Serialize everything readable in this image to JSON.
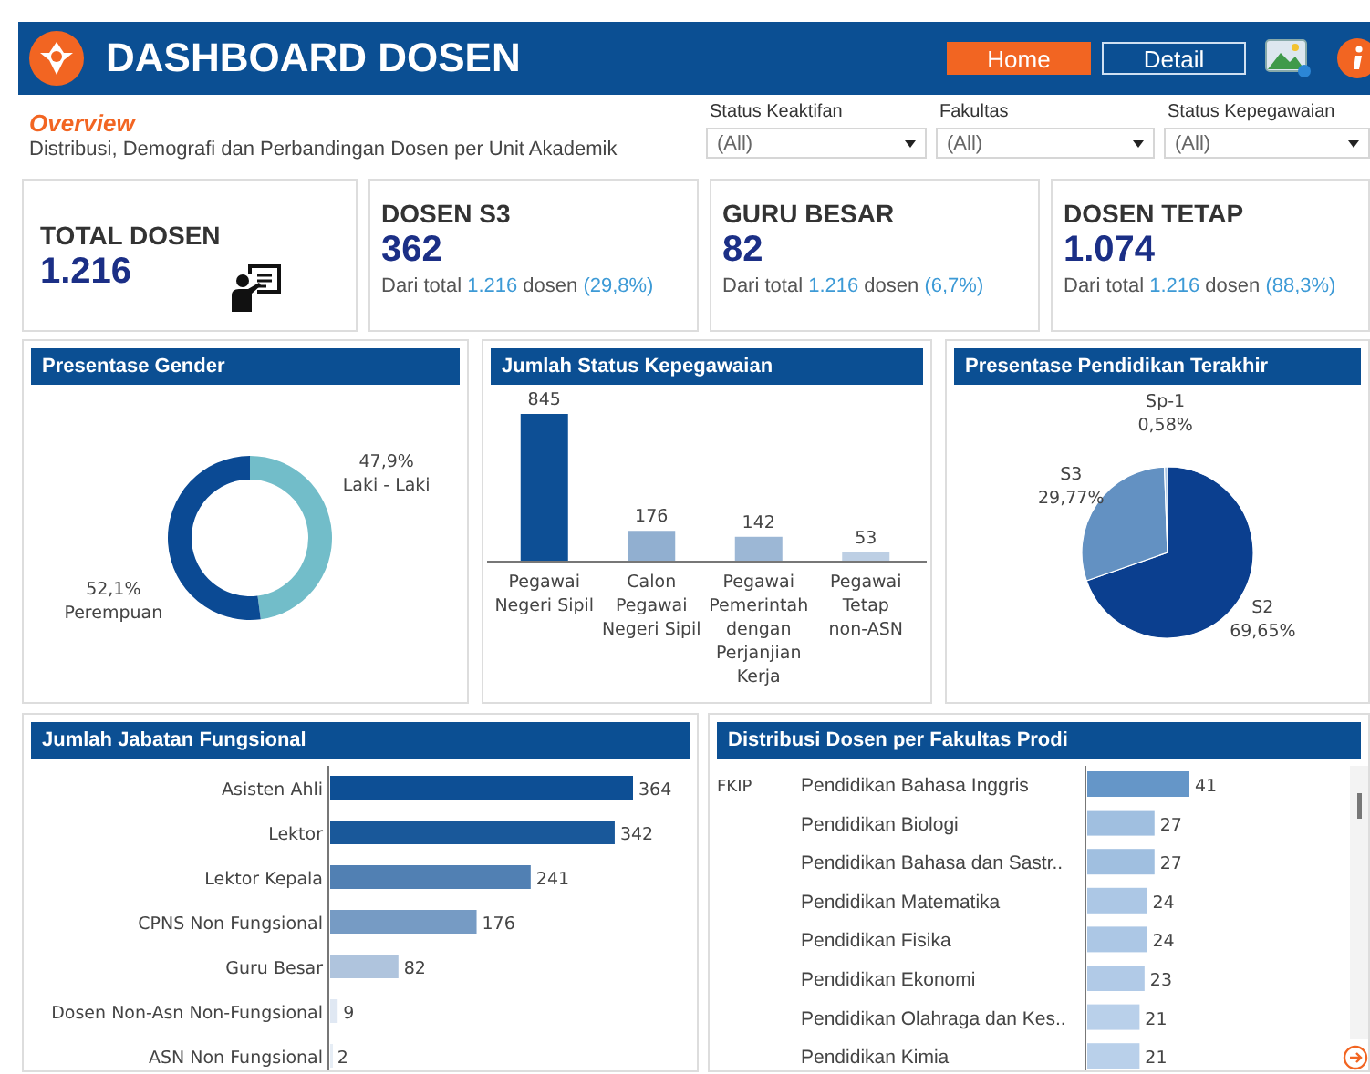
{
  "header": {
    "title": "DASHBOARD DOSEN",
    "nav": [
      {
        "label": "Home",
        "selected": true
      },
      {
        "label": "Detail",
        "selected": false
      }
    ]
  },
  "overview": {
    "title": "Overview",
    "subtitle": "Distribusi, Demografi dan Perbandingan Dosen per Unit Akademik"
  },
  "filters": [
    {
      "label": "Status Keaktifan",
      "value": "(All)"
    },
    {
      "label": "Fakultas",
      "value": "(All)"
    },
    {
      "label": "Status Kepegawaian",
      "value": "(All)"
    }
  ],
  "kpis": [
    {
      "kind": "icon",
      "title": "TOTAL DOSEN",
      "value": "1.216"
    },
    {
      "kind": "note",
      "title": "DOSEN S3",
      "value": "362",
      "note": {
        "prefix": "Dari total",
        "total": "1.216",
        "unit": "dosen",
        "share": "(29,8%)"
      }
    },
    {
      "kind": "note",
      "title": "GURU BESAR",
      "value": "82",
      "note": {
        "prefix": "Dari total",
        "total": "1.216",
        "unit": "dosen",
        "share": "(6,7%)"
      }
    },
    {
      "kind": "note",
      "title": "DOSEN TETAP",
      "value": "1.074",
      "note": {
        "prefix": "Dari total",
        "total": "1.216",
        "unit": "dosen",
        "share": "(88,3%)"
      }
    }
  ],
  "panels": [
    {
      "title": "Presentase Gender",
      "chart_data": {
        "type": "donut",
        "categories": [
          "Laki - Laki",
          "Perempuan"
        ],
        "values": [
          47.9,
          52.1
        ],
        "value_labels": [
          "47,9%",
          "52,1%"
        ],
        "colors": [
          "#72bdc9",
          "#0b4a94"
        ]
      }
    },
    {
      "title": "Jumlah Status Kepegawaian",
      "chart_data": {
        "type": "bar",
        "orientation": "vertical",
        "categories": [
          "Pegawai Negeri Sipil",
          "Calon Pegawai Negeri Sipil",
          "Pegawai Pemerintah dengan Perjanjian Kerja",
          "Pegawai Tetap non-ASN"
        ],
        "values": [
          845,
          176,
          142,
          53
        ],
        "data_labels": true
      }
    },
    {
      "title": "Presentase Pendidikan Terakhir",
      "chart_data": {
        "type": "pie",
        "categories": [
          "S2",
          "S3",
          "Sp-1"
        ],
        "values": [
          69.65,
          29.77,
          0.58
        ],
        "value_labels": [
          "69,65%",
          "29,77%",
          "0,58%"
        ],
        "colors": [
          "#0b3f8f",
          "#6391c2",
          "#a9c4e3"
        ]
      }
    },
    {
      "title": "Jumlah Jabatan Fungsional",
      "chart_data": {
        "type": "bar",
        "orientation": "horizontal",
        "categories": [
          "Asisten Ahli",
          "Lektor",
          "Lektor Kepala",
          "CPNS Non Fungsional",
          "Guru Besar",
          "Dosen Non-Asn Non-Fungsional",
          "ASN Non Fungsional"
        ],
        "values": [
          364,
          342,
          241,
          176,
          82,
          9,
          2
        ],
        "data_labels": true
      }
    },
    {
      "title": "Distribusi Dosen per Fakultas Prodi",
      "row_group": "FKIP",
      "chart_data": {
        "type": "bar",
        "orientation": "horizontal",
        "categories": [
          "Pendidikan Bahasa Inggris",
          "Pendidikan Biologi",
          "Pendidikan Bahasa dan Sastr..",
          "Pendidikan Matematika",
          "Pendidikan Fisika",
          "Pendidikan Ekonomi",
          "Pendidikan Olahraga dan Kes..",
          "Pendidikan Kimia"
        ],
        "values": [
          41,
          27,
          27,
          24,
          24,
          23,
          21,
          21
        ],
        "data_labels": true
      }
    }
  ]
}
